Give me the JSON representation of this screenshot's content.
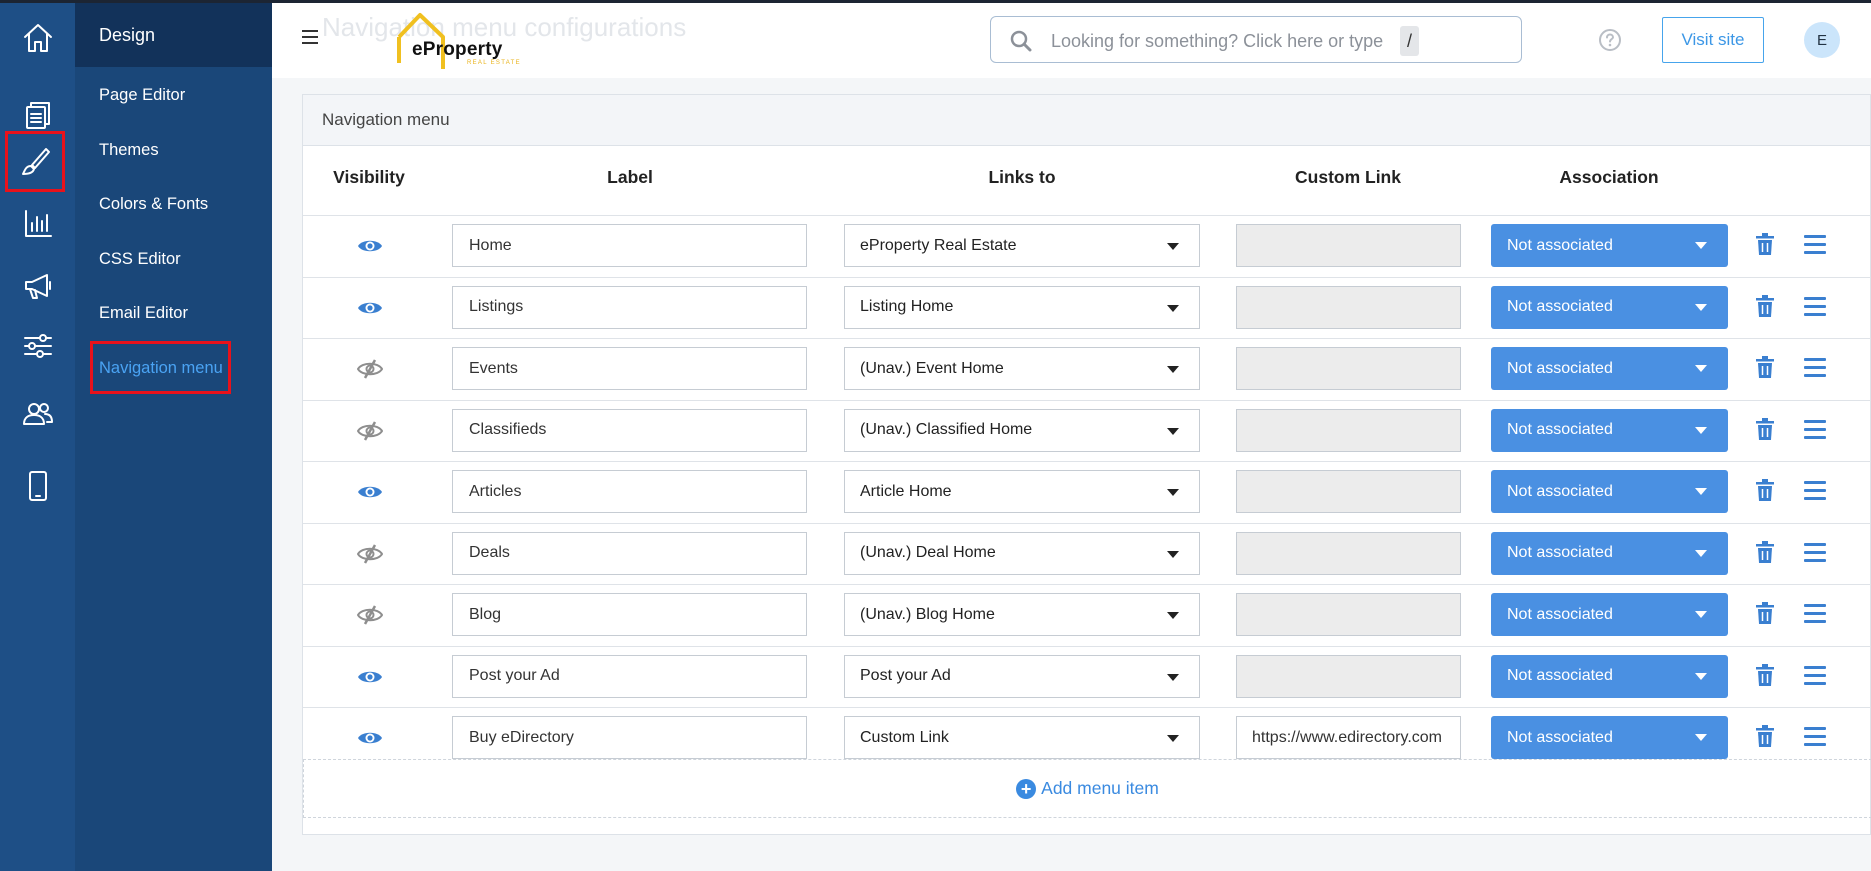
{
  "rail": {
    "items": [
      {
        "name": "home-icon",
        "active": false
      },
      {
        "name": "pages-icon",
        "active": false
      },
      {
        "name": "design-brush-icon",
        "active": true
      },
      {
        "name": "reports-chart-icon",
        "active": false
      },
      {
        "name": "promotion-megaphone-icon",
        "active": false
      },
      {
        "name": "settings-sliders-icon",
        "active": false
      },
      {
        "name": "users-icon",
        "active": false
      },
      {
        "name": "mobile-icon",
        "active": false
      }
    ]
  },
  "submenu": {
    "title": "Design",
    "items": [
      {
        "label": "Page Editor"
      },
      {
        "label": "Themes"
      },
      {
        "label": "Colors & Fonts"
      },
      {
        "label": "CSS Editor"
      },
      {
        "label": "Email Editor"
      },
      {
        "label": "Navigation menu",
        "current": true
      }
    ]
  },
  "header": {
    "logo_name": "eProperty",
    "logo_tag": "REAL ESTATE",
    "search_placeholder": "Looking for something? Click here or type",
    "search_key": "/",
    "visit_label": "Visit site",
    "avatar_initial": "E"
  },
  "panel": {
    "title": "Navigation menu",
    "columns": {
      "visibility": "Visibility",
      "label": "Label",
      "links_to": "Links to",
      "custom_link": "Custom Link",
      "association": "Association"
    },
    "rows": [
      {
        "visible": true,
        "label": "Home",
        "links_to": "eProperty Real Estate",
        "custom_link": "",
        "association": "Not associated"
      },
      {
        "visible": true,
        "label": "Listings",
        "links_to": "Listing Home",
        "custom_link": "",
        "association": "Not associated"
      },
      {
        "visible": false,
        "label": "Events",
        "links_to": "(Unav.) Event Home",
        "custom_link": "",
        "association": "Not associated"
      },
      {
        "visible": false,
        "label": "Classifieds",
        "links_to": "(Unav.) Classified Home",
        "custom_link": "",
        "association": "Not associated"
      },
      {
        "visible": true,
        "label": "Articles",
        "links_to": "Article Home",
        "custom_link": "",
        "association": "Not associated"
      },
      {
        "visible": false,
        "label": "Deals",
        "links_to": "(Unav.) Deal Home",
        "custom_link": "",
        "association": "Not associated"
      },
      {
        "visible": false,
        "label": "Blog",
        "links_to": "(Unav.) Blog Home",
        "custom_link": "",
        "association": "Not associated"
      },
      {
        "visible": true,
        "label": "Post your Ad",
        "links_to": "Post your Ad",
        "custom_link": "",
        "association": "Not associated"
      },
      {
        "visible": true,
        "label": "Buy eDirectory",
        "links_to": "Custom Link",
        "custom_link": "https://www.edirectory.com",
        "association": "Not associated"
      }
    ],
    "add_label": "Add menu item"
  },
  "colors": {
    "rail_bg": "#1e4f86",
    "submenu_bg": "#1a4779",
    "accent": "#4a90e2",
    "highlight": "#e8121b"
  }
}
